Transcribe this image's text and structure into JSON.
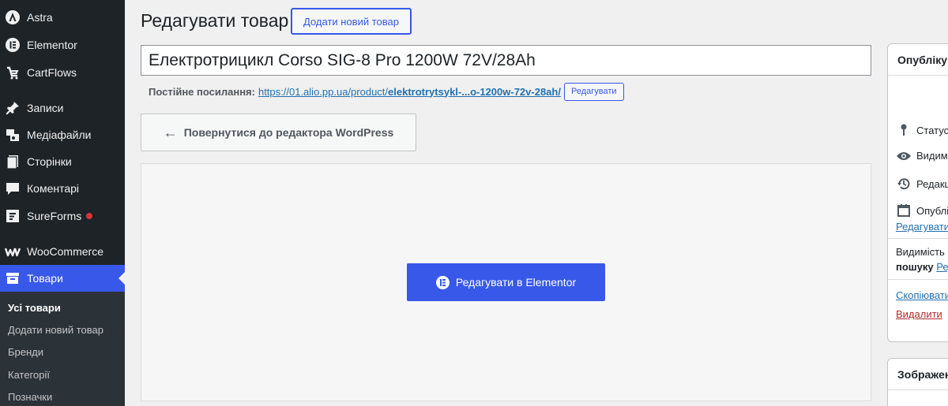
{
  "sidebar": {
    "items": [
      {
        "label": "Astra",
        "icon": "astra-icon"
      },
      {
        "label": "Elementor",
        "icon": "elementor-icon"
      },
      {
        "label": "CartFlows",
        "icon": "cartflows-icon"
      },
      {
        "label": "Записи",
        "icon": "pin-icon"
      },
      {
        "label": "Медіафайли",
        "icon": "media-icon"
      },
      {
        "label": "Сторінки",
        "icon": "pages-icon"
      },
      {
        "label": "Коментарі",
        "icon": "comments-icon"
      },
      {
        "label": "SureForms",
        "icon": "sureforms-icon"
      },
      {
        "label": "WooCommerce",
        "icon": "woocommerce-icon"
      },
      {
        "label": "Товари",
        "icon": "products-icon"
      }
    ],
    "submenu": [
      "Усі товари",
      "Додати новий товар",
      "Бренди",
      "Категорії",
      "Позначки"
    ],
    "accent_color": "#3858e9",
    "notification_color": "#d63638"
  },
  "header": {
    "title": "Редагувати товар",
    "add_new_label": "Додати новий товар"
  },
  "product": {
    "title": "Електротрицикл Corso SIG-8 Pro 1200W 72V/28Ah"
  },
  "permalink": {
    "label": "Постійне посилання:",
    "url_prefix": "https://01.alio.pp.ua/product/",
    "url_slug": "elektrotrytsykl-...o-1200w-72v-28ah/",
    "edit_label": "Редагувати"
  },
  "editor": {
    "back_label": "Повернутися до редактора WordPress",
    "elementor_label": "Редагувати в Elementor"
  },
  "publish": {
    "title": "Опублікувати",
    "status": "Статус:",
    "visibility": "Видимість:",
    "revisions": "Редакції:",
    "published": "Опубліковано",
    "edit_link": "Редагувати",
    "catalog_visibility_1": "Видимість в каталозі:",
    "catalog_visibility_2": "пошуку",
    "catalog_edit": "Редагувати",
    "copy_link": "Скопіювати",
    "delete_link": "Видалити"
  },
  "image_box": {
    "title": "Зображення"
  }
}
